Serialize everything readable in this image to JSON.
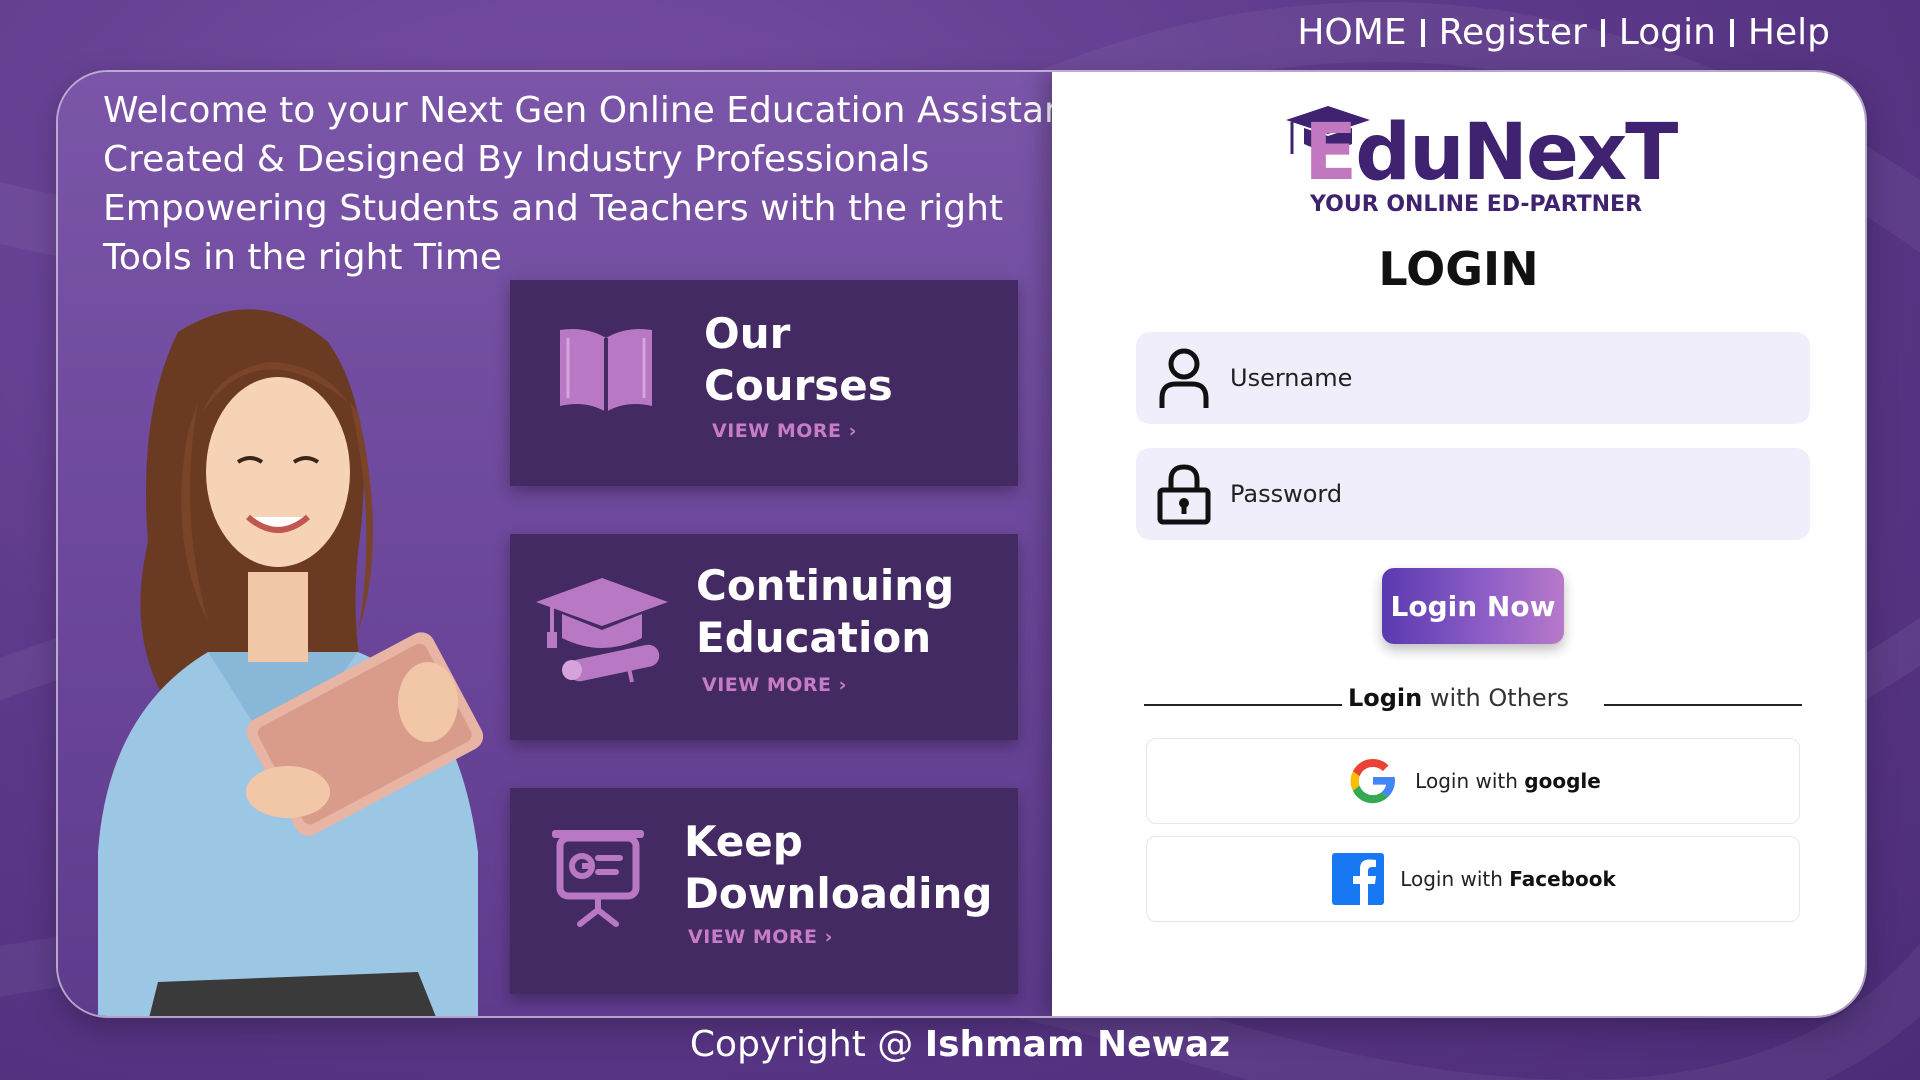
{
  "nav": {
    "items": [
      {
        "label": "HOME"
      },
      {
        "label": "Register"
      },
      {
        "label": "Login"
      },
      {
        "label": "Help"
      }
    ]
  },
  "welcome": {
    "lines": [
      "Welcome to your Next Gen Online Education Assistant.",
      "Created & Designed By Industry Professionals",
      "Empowering Students and Teachers with the right",
      "Tools in the right Time"
    ]
  },
  "tiles": [
    {
      "title_lines": [
        "Our",
        "Courses"
      ],
      "more": "VIEW MORE ›",
      "icon": "open-book-icon"
    },
    {
      "title_lines": [
        "Continuing",
        "Education"
      ],
      "more": "VIEW MORE ›",
      "icon": "graduation-cap-icon"
    },
    {
      "title_lines": [
        "Keep",
        "Downloading"
      ],
      "more": "VIEW MORE ›",
      "icon": "presentation-board-icon"
    }
  ],
  "brand": {
    "name_first": "E",
    "name_rest": "duNexT",
    "tagline": "YOUR ONLINE ED-PARTNER",
    "primary_color": "#3f2270",
    "accent_color": "#c278c0"
  },
  "login": {
    "title": "LOGIN",
    "username_placeholder": "Username",
    "password_placeholder": "Password",
    "submit_label": "Login Now",
    "others_bold": "Login",
    "others_rest": " with Others",
    "google_prefix": "Login with ",
    "google_bold": "google",
    "facebook_prefix": "Login with ",
    "facebook_bold": "Facebook"
  },
  "footer": {
    "prefix": "Copyright @ ",
    "author": "Ishmam Newaz"
  }
}
